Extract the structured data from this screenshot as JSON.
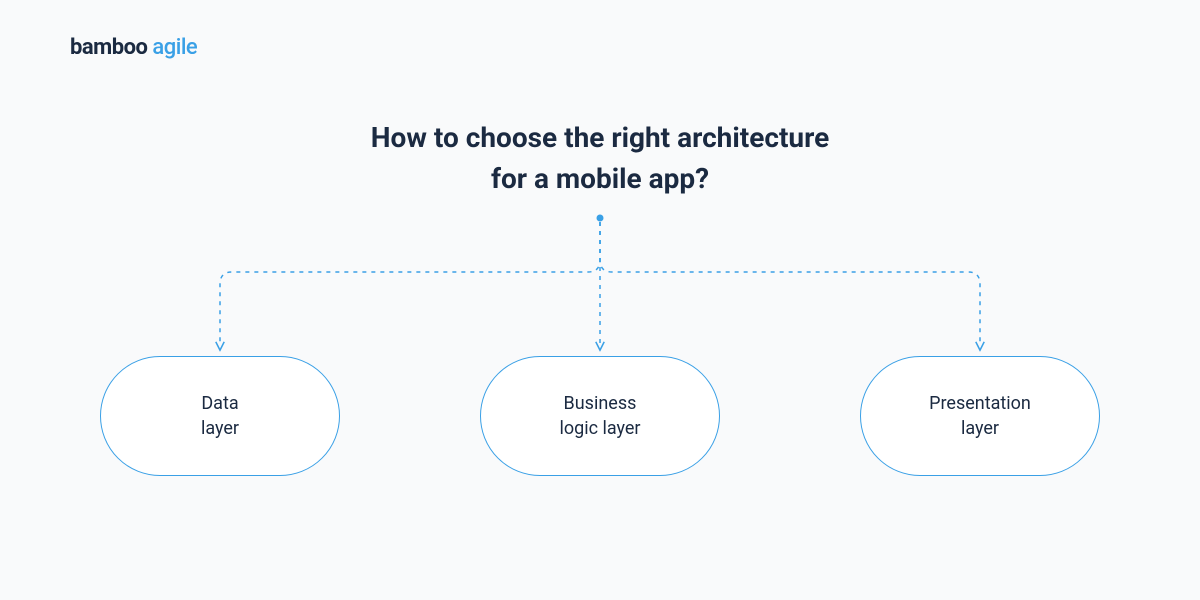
{
  "brand": {
    "word1": "bamboo",
    "word2": "agile"
  },
  "title_line1": "How to choose the right architecture",
  "title_line2": "for a mobile app?",
  "nodes": [
    {
      "label": "Data\nlayer"
    },
    {
      "label": "Business\nlogic layer"
    },
    {
      "label": "Presentation\nlayer"
    }
  ],
  "colors": {
    "accent": "#3aa0e6",
    "text": "#1b2a41",
    "bg": "#f9fafb",
    "node_bg": "#ffffff"
  }
}
